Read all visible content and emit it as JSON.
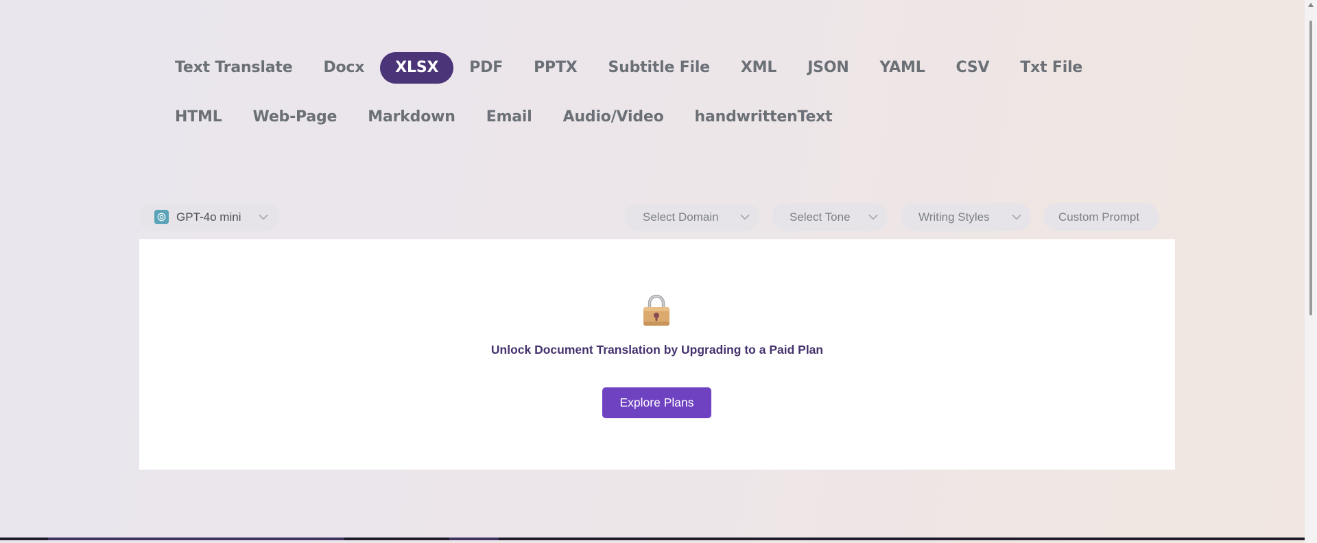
{
  "tabs": [
    {
      "label": "Text Translate",
      "active": false
    },
    {
      "label": "Docx",
      "active": false
    },
    {
      "label": "XLSX",
      "active": true
    },
    {
      "label": "PDF",
      "active": false
    },
    {
      "label": "PPTX",
      "active": false
    },
    {
      "label": "Subtitle File",
      "active": false
    },
    {
      "label": "XML",
      "active": false
    },
    {
      "label": "JSON",
      "active": false
    },
    {
      "label": "YAML",
      "active": false
    },
    {
      "label": "CSV",
      "active": false
    },
    {
      "label": "Txt File",
      "active": false
    },
    {
      "label": "HTML",
      "active": false
    },
    {
      "label": "Web-Page",
      "active": false
    },
    {
      "label": "Markdown",
      "active": false
    },
    {
      "label": "Email",
      "active": false
    },
    {
      "label": "Audio/Video",
      "active": false
    },
    {
      "label": "handwrittenText",
      "active": false
    }
  ],
  "toolbar": {
    "model": {
      "label": "GPT-4o mini",
      "icon": "openai-icon"
    },
    "domain_label": "Select Domain",
    "tone_label": "Select Tone",
    "styles_label": "Writing Styles",
    "custom_prompt_label": "Custom Prompt"
  },
  "panel": {
    "icon": "lock-icon",
    "message": "Unlock Document Translation by Upgrading to a Paid Plan",
    "button_label": "Explore Plans"
  },
  "colors": {
    "active_tab": "#4b3478",
    "button": "#6f42c1",
    "message": "#45326d"
  }
}
